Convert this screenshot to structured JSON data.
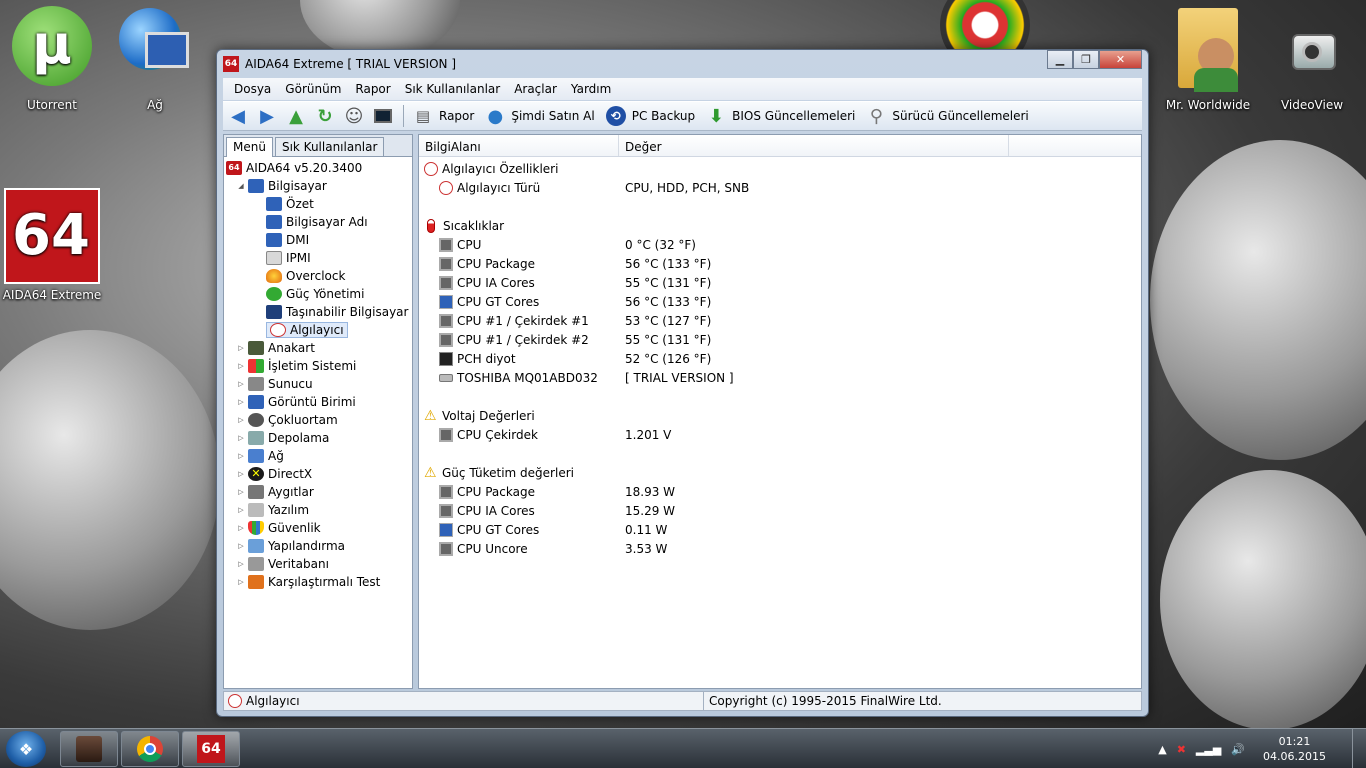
{
  "desktop": {
    "icons": [
      {
        "label": "Utorrent",
        "icon": "utorrent-icon"
      },
      {
        "label": "Ağ",
        "icon": "network-icon"
      },
      {
        "label": "AIDA64 Extreme",
        "icon": "aida64-icon"
      },
      {
        "label": "Mr. Worldwide",
        "icon": "user-folder-icon"
      },
      {
        "label": "VideoView",
        "icon": "webcam-icon"
      }
    ]
  },
  "window": {
    "app_icon": "64",
    "title": "AIDA64 Extreme  [ TRIAL VERSION ]",
    "controls": {
      "minimize": "▁",
      "maximize": "❐",
      "close": "✕"
    }
  },
  "menu": [
    "Dosya",
    "Görünüm",
    "Rapor",
    "Sık Kullanılanlar",
    "Araçlar",
    "Yardım"
  ],
  "toolbar": {
    "nav_icons": [
      "back-arrow-icon",
      "forward-arrow-icon",
      "up-arrow-icon",
      "refresh-icon",
      "user-icon",
      "monitor-icon"
    ],
    "buttons": [
      {
        "label": "Rapor",
        "icon": "report-icon"
      },
      {
        "label": "Şimdi Satın Al",
        "icon": "globe-icon"
      },
      {
        "label": "PC Backup",
        "icon": "backup-icon"
      },
      {
        "label": "BIOS Güncellemeleri",
        "icon": "download-icon"
      },
      {
        "label": "Sürücü Güncellemeleri",
        "icon": "search-icon"
      }
    ]
  },
  "tabs": [
    "Menü",
    "Sık Kullanılanlar"
  ],
  "tree": {
    "root": "AIDA64 v5.20.3400",
    "computer": "Bilgisayar",
    "computer_children": [
      "Özet",
      "Bilgisayar Adı",
      "DMI",
      "IPMI",
      "Overclock",
      "Güç Yönetimi",
      "Taşınabilir Bilgisayar",
      "Algılayıcı"
    ],
    "others": [
      "Anakart",
      "İşletim Sistemi",
      "Sunucu",
      "Görüntü Birimi",
      "Çokluortam",
      "Depolama",
      "Ağ",
      "DirectX",
      "Aygıtlar",
      "Yazılım",
      "Güvenlik",
      "Yapılandırma",
      "Veritabanı",
      "Karşılaştırmalı Test"
    ]
  },
  "columns": {
    "field": "BilgiAlanı",
    "value": "Değer"
  },
  "groups": [
    {
      "title": "Algılayıcı Özellikleri",
      "icon": "sensor-icon",
      "rows": [
        [
          "Algılayıcı Türü",
          "CPU, HDD, PCH, SNB"
        ]
      ]
    },
    {
      "title": "Sıcaklıklar",
      "icon": "thermometer-icon",
      "rows": [
        [
          "CPU",
          "0 °C  (32 °F)"
        ],
        [
          "CPU Package",
          "56 °C  (133 °F)"
        ],
        [
          "CPU IA Cores",
          "55 °C  (131 °F)"
        ],
        [
          "CPU GT Cores",
          "56 °C  (133 °F)"
        ],
        [
          "CPU #1 / Çekirdek #1",
          "53 °C  (127 °F)"
        ],
        [
          "CPU #1 / Çekirdek #2",
          "55 °C  (131 °F)"
        ],
        [
          "PCH diyot",
          "52 °C  (126 °F)"
        ],
        [
          "TOSHIBA MQ01ABD032",
          "[ TRIAL VERSION ]"
        ]
      ]
    },
    {
      "title": "Voltaj Değerleri",
      "icon": "warning-icon",
      "rows": [
        [
          "CPU Çekirdek",
          "1.201 V"
        ]
      ]
    },
    {
      "title": "Güç Tüketim değerleri",
      "icon": "warning-icon",
      "rows": [
        [
          "CPU Package",
          "18.93 W"
        ],
        [
          "CPU IA Cores",
          "15.29 W"
        ],
        [
          "CPU GT Cores",
          "0.11 W"
        ],
        [
          "CPU Uncore",
          "3.53 W"
        ]
      ]
    }
  ],
  "status": {
    "left": "Algılayıcı",
    "right": "Copyright (c) 1995-2015 FinalWire Ltd."
  },
  "taskbar": {
    "apps": [
      "media-app-icon",
      "chrome-icon",
      "aida64-icon"
    ],
    "time": "01:21",
    "date": "04.06.2015"
  }
}
